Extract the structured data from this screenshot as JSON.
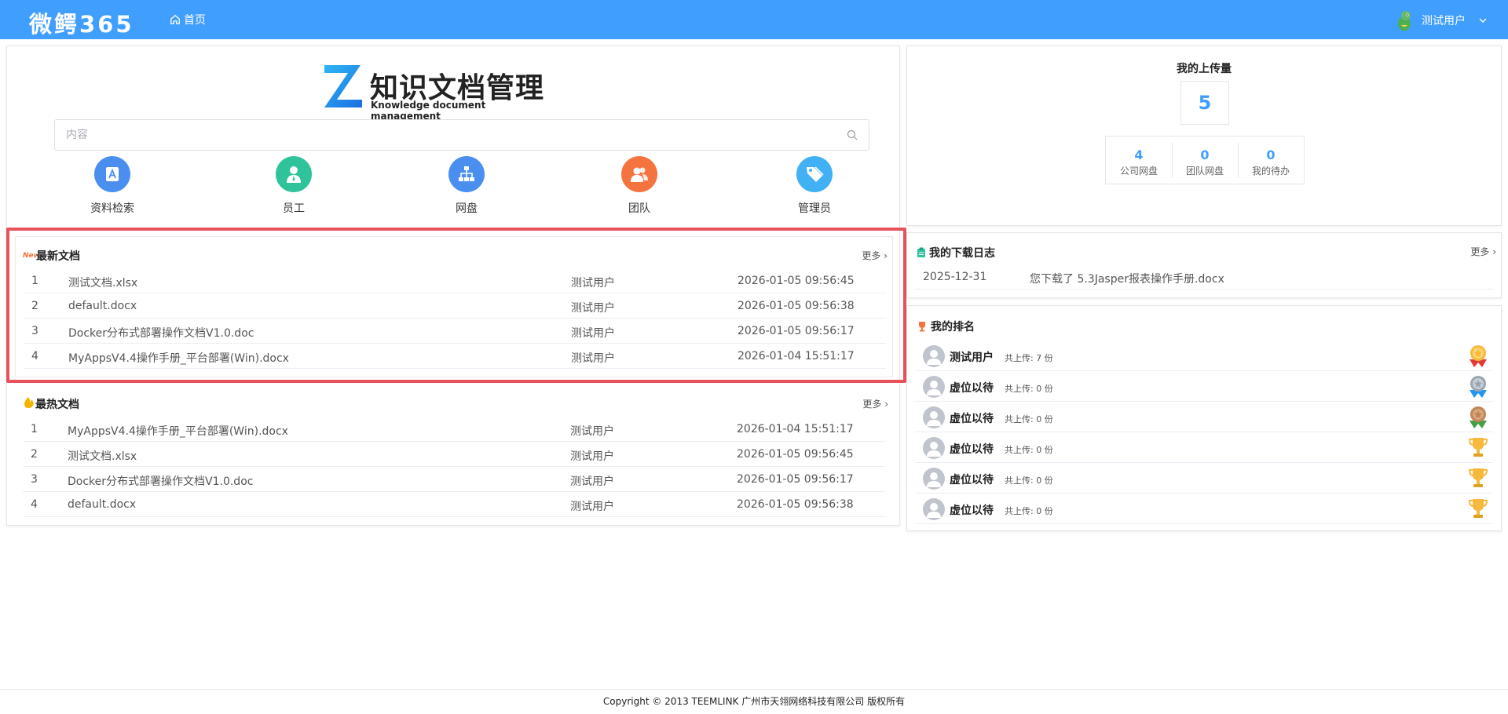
{
  "header": {
    "brand": "微鳄365",
    "nav_home": "首页",
    "user_name": "测试用户"
  },
  "logo": {
    "title": "知识文档管理",
    "subtitle": "Knowledge document management"
  },
  "search": {
    "placeholder": "内容",
    "value": ""
  },
  "quick_actions": [
    {
      "label": "资料检索",
      "icon": "search-doc-icon",
      "color": "#4a8ff0"
    },
    {
      "label": "员工",
      "icon": "employee-icon",
      "color": "#2ec39a"
    },
    {
      "label": "网盘",
      "icon": "network-disk-icon",
      "color": "#4a8ff0"
    },
    {
      "label": "团队",
      "icon": "team-icon",
      "color": "#f5733f"
    },
    {
      "label": "管理员",
      "icon": "admin-tag-icon",
      "color": "#42b0f5"
    }
  ],
  "latest_docs": {
    "title": "最新文档",
    "more": "更多",
    "rows": [
      {
        "idx": "1",
        "name": "测试文档.xlsx",
        "user": "测试用户",
        "time": "2026-01-05 09:56:45"
      },
      {
        "idx": "2",
        "name": "default.docx",
        "user": "测试用户",
        "time": "2026-01-05 09:56:38"
      },
      {
        "idx": "3",
        "name": "Docker分布式部署操作文档V1.0.doc",
        "user": "测试用户",
        "time": "2026-01-05 09:56:17"
      },
      {
        "idx": "4",
        "name": "MyAppsV4.4操作手册_平台部署(Win).docx",
        "user": "测试用户",
        "time": "2026-01-04 15:51:17"
      }
    ]
  },
  "hot_docs": {
    "title": "最热文档",
    "more": "更多",
    "rows": [
      {
        "idx": "1",
        "name": "MyAppsV4.4操作手册_平台部署(Win).docx",
        "user": "测试用户",
        "time": "2026-01-04 15:51:17"
      },
      {
        "idx": "2",
        "name": "测试文档.xlsx",
        "user": "测试用户",
        "time": "2026-01-05 09:56:45"
      },
      {
        "idx": "3",
        "name": "Docker分布式部署操作文档V1.0.doc",
        "user": "测试用户",
        "time": "2026-01-05 09:56:17"
      },
      {
        "idx": "4",
        "name": "default.docx",
        "user": "测试用户",
        "time": "2026-01-05 09:56:38"
      }
    ]
  },
  "upload": {
    "title": "我的上传量",
    "total": "5",
    "stats": [
      {
        "value": "4",
        "label": "公司网盘"
      },
      {
        "value": "0",
        "label": "团队网盘"
      },
      {
        "value": "0",
        "label": "我的待办"
      }
    ]
  },
  "download_log": {
    "title": "我的下载日志",
    "more": "更多",
    "rows": [
      {
        "date": "2025-12-31",
        "message": "您下载了 5.3Jasper报表操作手册.docx"
      }
    ]
  },
  "ranking": {
    "title": "我的排名",
    "rows": [
      {
        "name": "测试用户",
        "sub": "共上传: 7 份",
        "medal": "gold-medal-icon"
      },
      {
        "name": "虚位以待",
        "sub": "共上传: 0 份",
        "medal": "silver-medal-icon"
      },
      {
        "name": "虚位以待",
        "sub": "共上传: 0 份",
        "medal": "bronze-medal-icon"
      },
      {
        "name": "虚位以待",
        "sub": "共上传: 0 份",
        "medal": "trophy-icon"
      },
      {
        "name": "虚位以待",
        "sub": "共上传: 0 份",
        "medal": "trophy-icon"
      },
      {
        "name": "虚位以待",
        "sub": "共上传: 0 份",
        "medal": "trophy-icon"
      }
    ]
  },
  "footer": {
    "text": "Copyright © 2013 TEEMLINK 广州市天翎网络科技有限公司 版权所有"
  },
  "colors": {
    "header_bg": "#409eff",
    "accent": "#409eff",
    "highlight_border": "#e8525b"
  }
}
